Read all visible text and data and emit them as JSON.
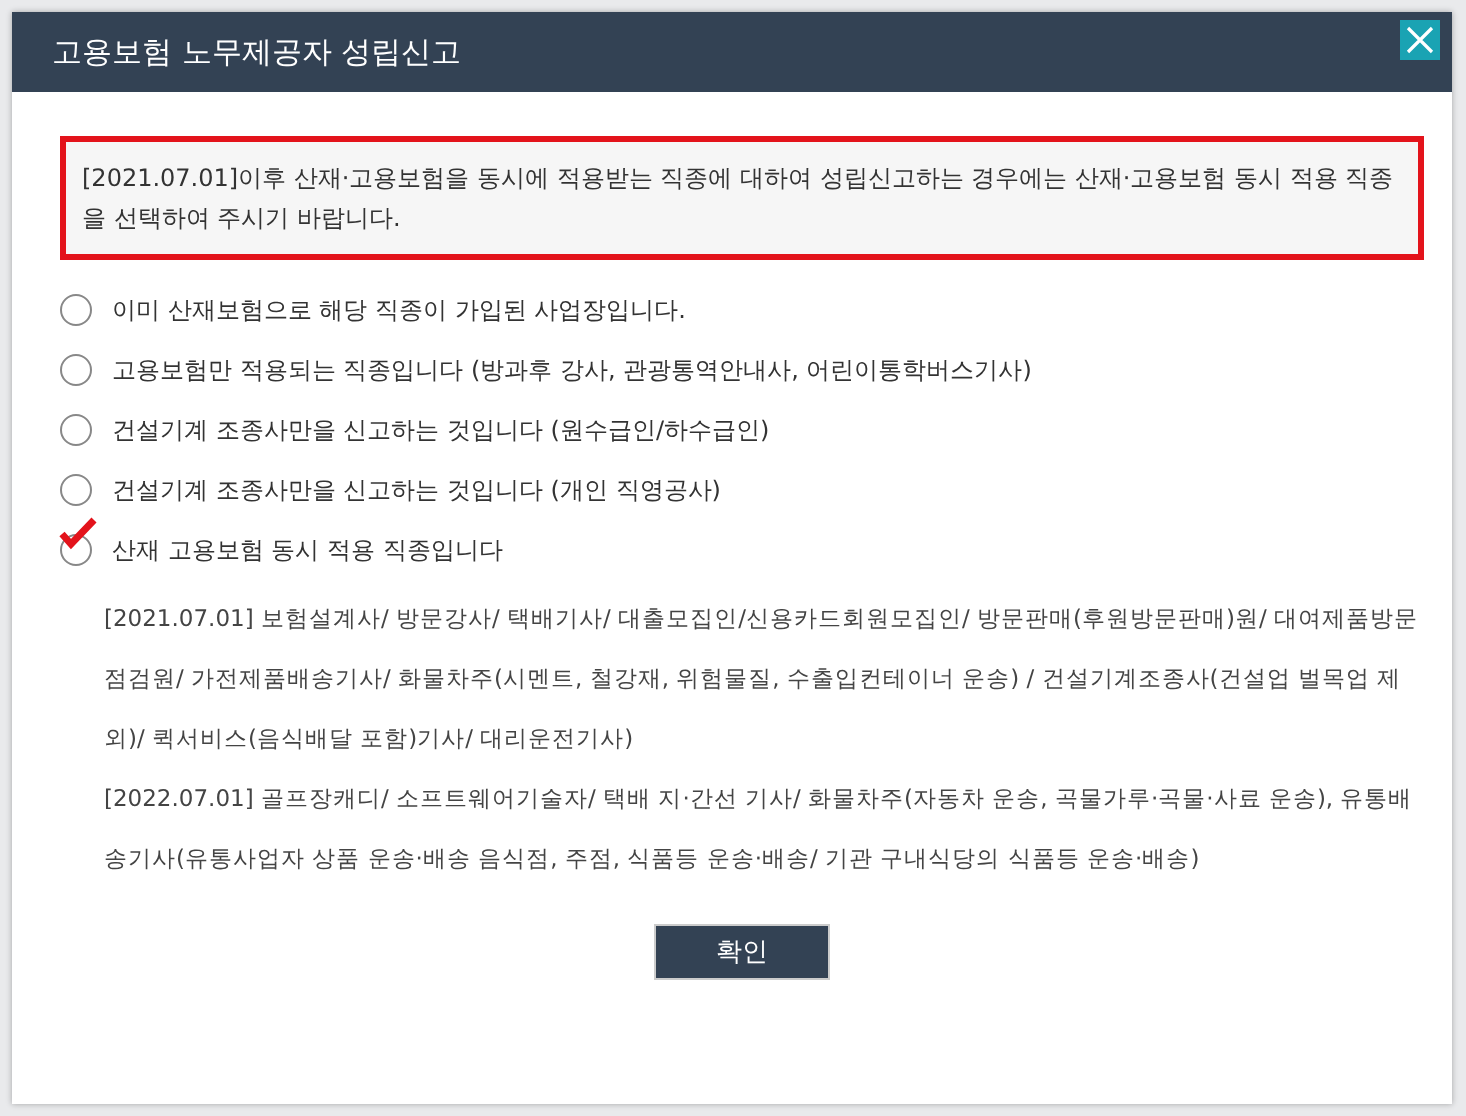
{
  "dialog": {
    "title": "고용보험 노무제공자 성립신고",
    "notice": "[2021.07.01]이후 산재·고용보험을 동시에 적용받는 직종에 대하여 성립신고하는 경우에는 산재·고용보험 동시 적용 직종을 선택하여 주시기 바랍니다.",
    "options": [
      {
        "label": "이미 산재보험으로 해당 직종이 가입된 사업장입니다.",
        "selected": false
      },
      {
        "label": "고용보험만 적용되는 직종입니다 (방과후 강사, 관광통역안내사, 어린이통학버스기사)",
        "selected": false
      },
      {
        "label": "건설기계 조종사만을 신고하는 것입니다 (원수급인/하수급인)",
        "selected": false
      },
      {
        "label": "건설기계 조종사만을 신고하는 것입니다 (개인 직영공사)",
        "selected": false
      },
      {
        "label": "산재 고용보험 동시 적용 직종입니다",
        "selected": true
      }
    ],
    "details": [
      "[2021.07.01] 보험설계사/ 방문강사/ 택배기사/ 대출모집인/신용카드회원모집인/ 방문판매(후원방문판매)원/ 대여제품방문점검원/ 가전제품배송기사/ 화물차주(시멘트, 철강재, 위험물질, 수출입컨테이너 운송) / 건설기계조종사(건설업 벌목업 제외)/ 퀵서비스(음식배달 포함)기사/ 대리운전기사)",
      "[2022.07.01] 골프장캐디/ 소프트웨어기술자/ 택배 지·간선 기사/ 화물차주(자동차 운송, 곡물가루·곡물·사료 운송), 유통배송기사(유통사업자 상품 운송·배송 음식점, 주점, 식품등 운송·배송/ 기관 구내식당의 식품등 운송·배송)"
    ],
    "confirm_button": "확인"
  }
}
